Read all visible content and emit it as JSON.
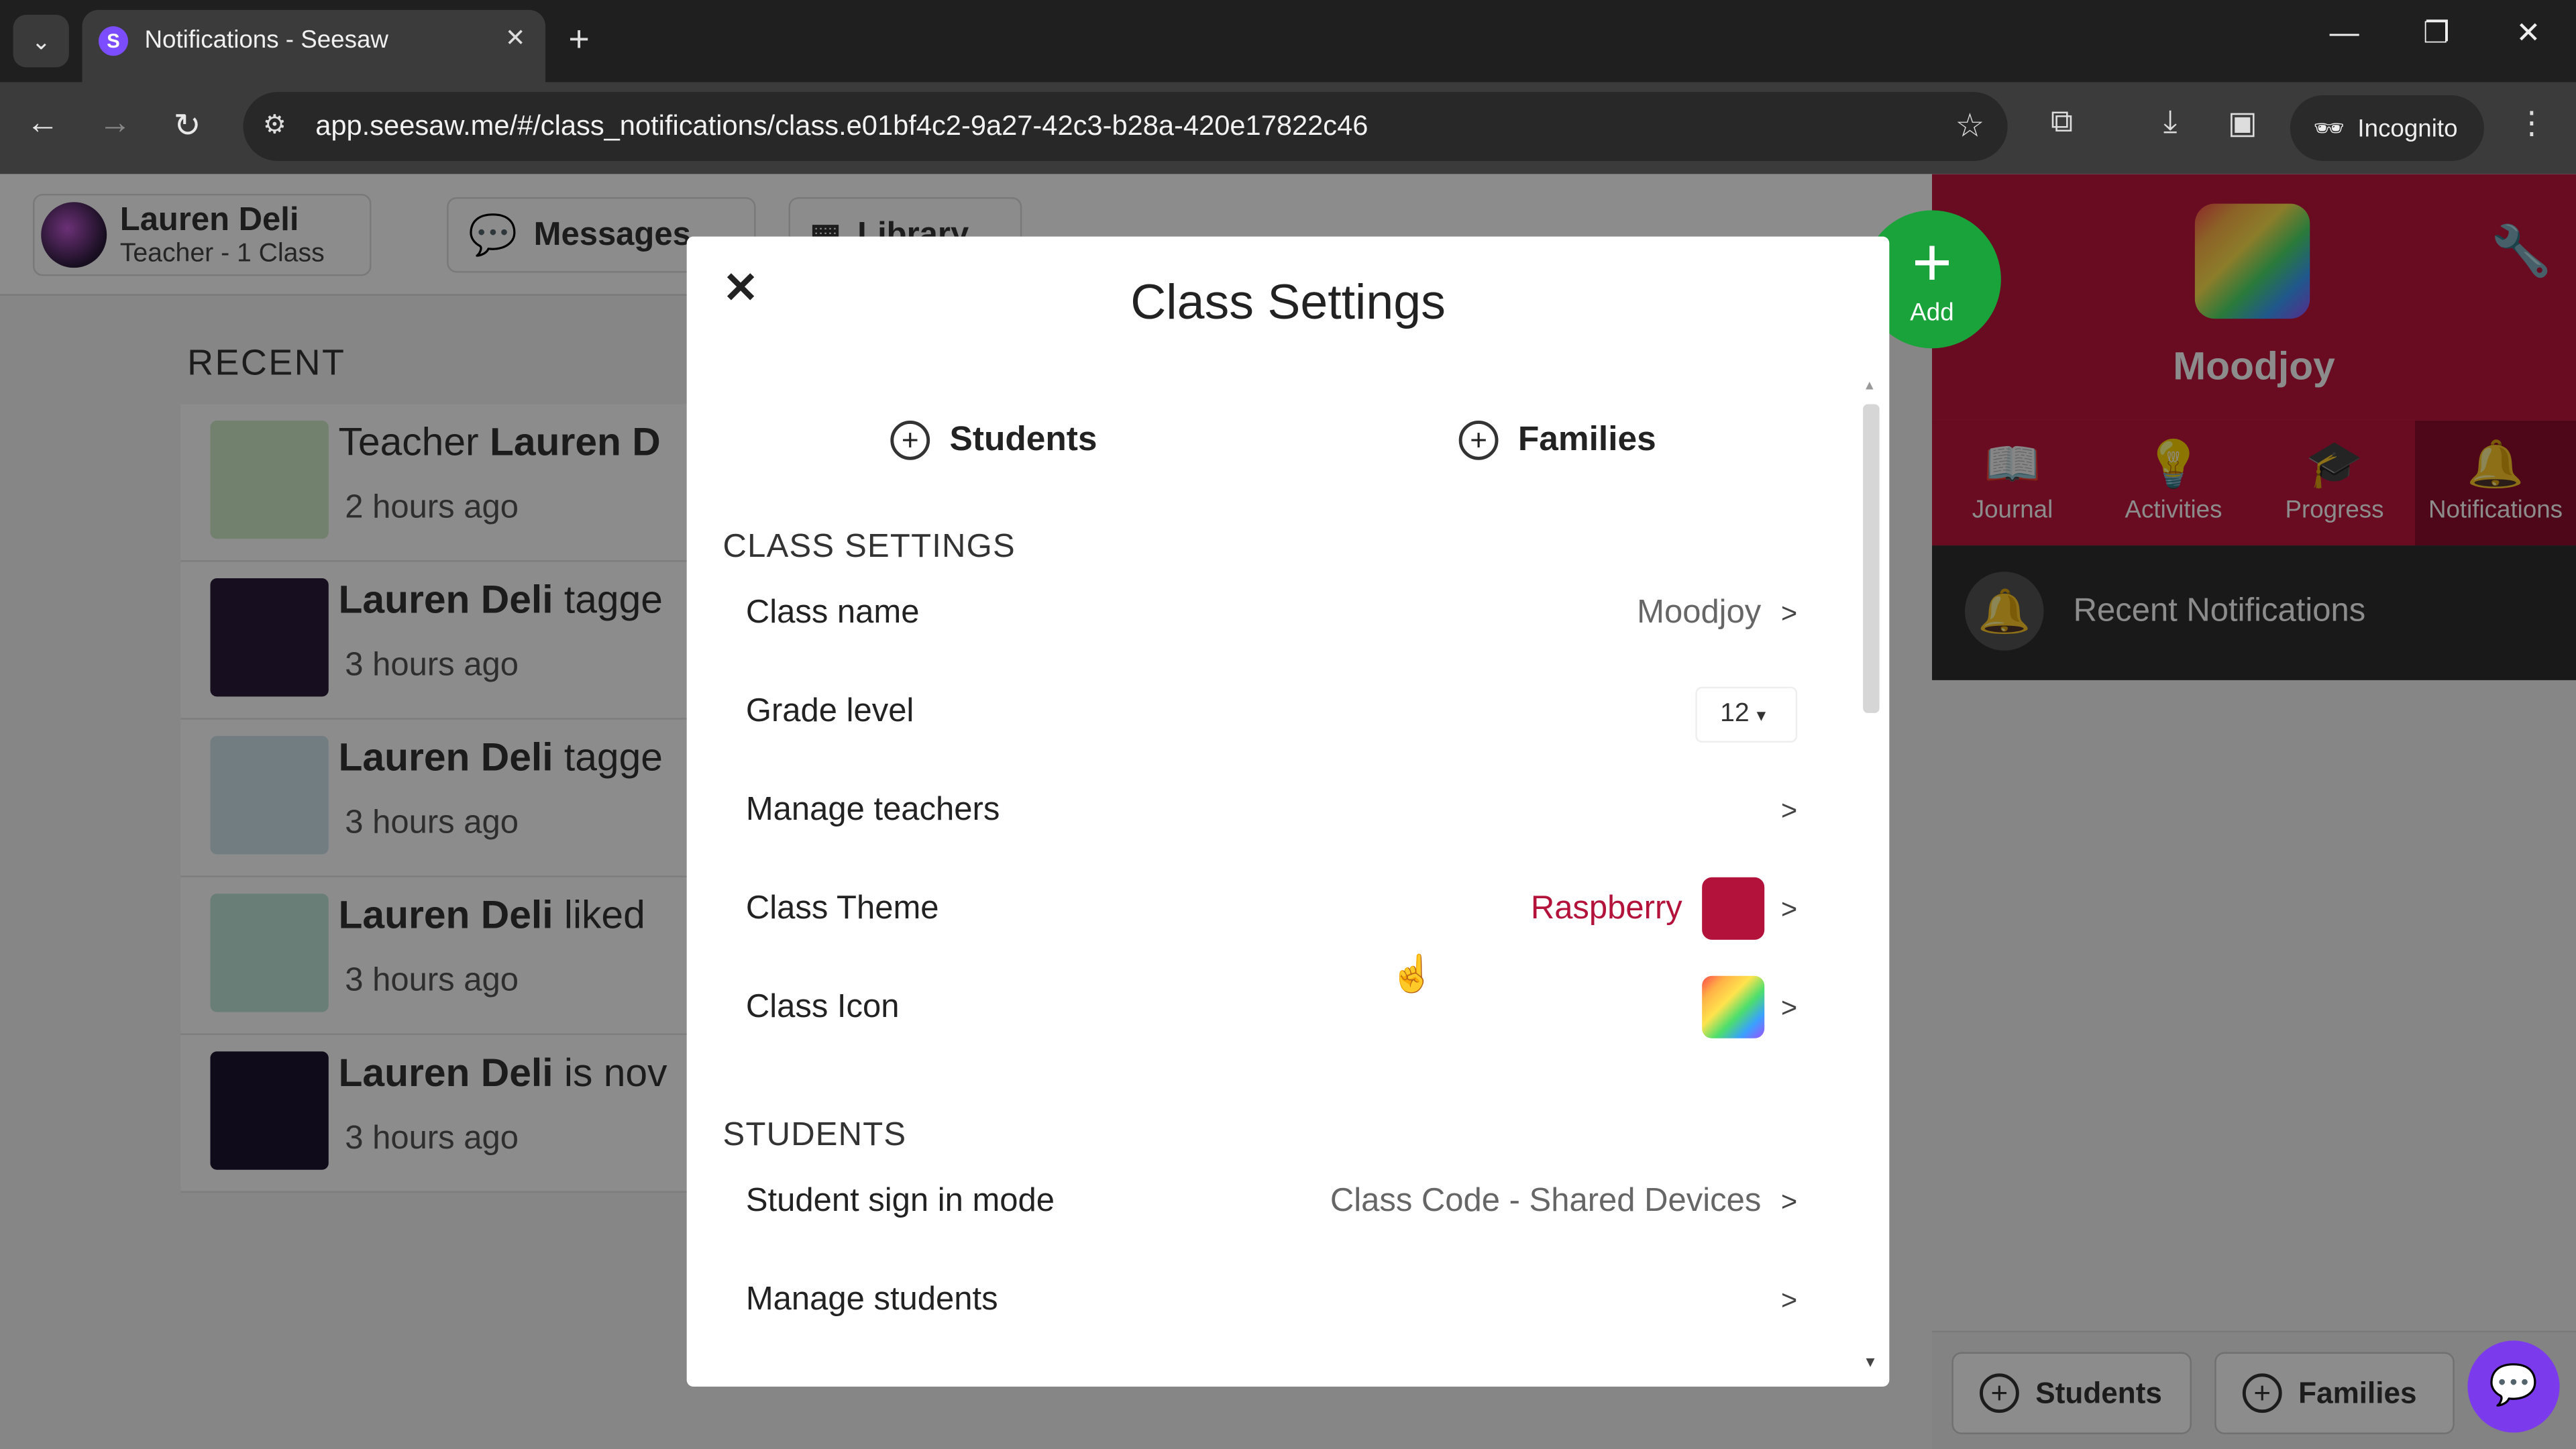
{
  "browser": {
    "tab_title": "Notifications - Seesaw",
    "favicon_letter": "S",
    "url": "app.seesaw.me/#/class_notifications/class.e01bf4c2-9a27-42c3-b28a-420e17822c46",
    "incognito_label": "Incognito"
  },
  "header": {
    "user_name": "Lauren Deli",
    "user_role": "Teacher - 1 Class",
    "messages_label": "Messages",
    "library_label": "Library"
  },
  "recent": {
    "title": "RECENT",
    "items": [
      {
        "prefix": "Teacher ",
        "bold": "Lauren D",
        "suffix": "",
        "time": "2 hours ago",
        "thumb_color": "#cfe9c9"
      },
      {
        "prefix": "",
        "bold": "Lauren Deli",
        "suffix": " tagge",
        "time": "3 hours ago",
        "thumb_color": "#2b1c3a"
      },
      {
        "prefix": "",
        "bold": "Lauren Deli",
        "suffix": " tagge",
        "time": "3 hours ago",
        "thumb_color": "#cfe4ec"
      },
      {
        "prefix": "",
        "bold": "Lauren Deli",
        "suffix": " liked",
        "time": "3 hours ago",
        "thumb_color": "#bfe6d8"
      },
      {
        "prefix": "",
        "bold": "Lauren Deli",
        "suffix": " is nov",
        "time": "3 hours ago",
        "thumb_color": "#1e1530"
      }
    ]
  },
  "class_panel": {
    "add_label": "Add",
    "class_name": "Moodjoy",
    "theme_color": "#c0143c",
    "tabs": [
      {
        "label": "Journal",
        "icon": "book-icon"
      },
      {
        "label": "Activities",
        "icon": "lightbulb-icon"
      },
      {
        "label": "Progress",
        "icon": "graduation-cap-icon"
      },
      {
        "label": "Notifications",
        "icon": "bell-icon"
      }
    ],
    "recent_notifications_label": "Recent Notifications",
    "students_btn": "Students",
    "families_btn": "Families"
  },
  "modal": {
    "title": "Class Settings",
    "students_btn": "Students",
    "families_btn": "Families",
    "class_settings_section": "CLASS SETTINGS",
    "class_name_label": "Class name",
    "class_name_value": "Moodjoy",
    "grade_level_label": "Grade level",
    "grade_level_value": "12",
    "manage_teachers_label": "Manage teachers",
    "class_theme_label": "Class Theme",
    "class_theme_value": "Raspberry",
    "class_icon_label": "Class Icon",
    "students_section": "STUDENTS",
    "sign_in_mode_label": "Student sign in mode",
    "sign_in_mode_value": "Class Code - Shared Devices",
    "manage_students_label": "Manage students",
    "chevron": ">"
  }
}
